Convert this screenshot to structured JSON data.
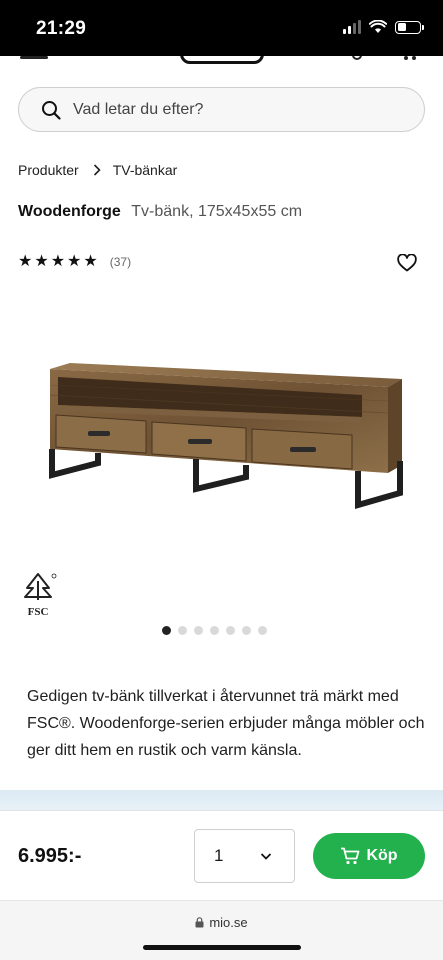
{
  "status_bar": {
    "time": "21:29"
  },
  "search": {
    "placeholder": "Vad letar du efter?"
  },
  "breadcrumb": {
    "items": [
      "Produkter",
      "TV-bänkar"
    ]
  },
  "product": {
    "brand": "Woodenforge",
    "description_short": "Tv-bänk, 175x45x55 cm",
    "rating": 5,
    "review_count": "(37)",
    "certification": "FSC",
    "image_count": 7,
    "active_image": 0,
    "description": "Gedigen tv-bänk tillverkat i återvunnet trä märkt med FSC®. Woodenforge-serien erbjuder många möbler och ger ditt hem en rustik och varm känsla."
  },
  "buy_bar": {
    "price": "6.995:-",
    "quantity": "1",
    "buy_label": "Köp"
  },
  "browser": {
    "url": "mio.se"
  },
  "colors": {
    "accent_green": "#22b14c",
    "text": "#1a1a1a"
  }
}
